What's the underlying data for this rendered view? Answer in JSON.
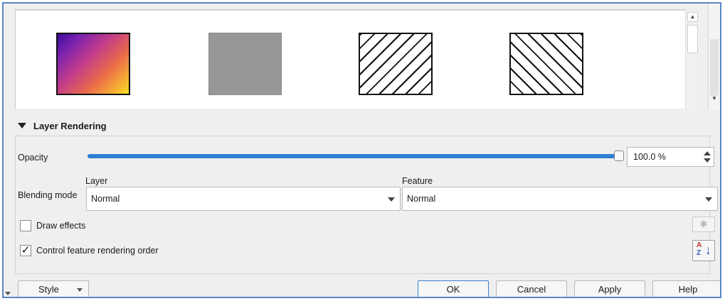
{
  "preview": {
    "symbols": [
      "gradient-fill",
      "solid-gray-fill",
      "hatch-fill-forward",
      "hatch-fill-back"
    ]
  },
  "layer_rendering": {
    "title": "Layer Rendering",
    "opacity_label": "Opacity",
    "opacity_value": "100.0 %",
    "opacity_fraction": 1.0,
    "blending_mode_label": "Blending mode",
    "layer_label": "Layer",
    "feature_label": "Feature",
    "layer_blend": "Normal",
    "feature_blend": "Normal",
    "draw_effects_label": "Draw effects",
    "draw_effects_checked": false,
    "order_label": "Control feature rendering order",
    "order_checked": true,
    "check_mark": "✓"
  },
  "buttons": {
    "style": "Style",
    "ok": "OK",
    "cancel": "Cancel",
    "apply": "Apply",
    "help": "Help"
  },
  "icons": {
    "collapse": "triangle-down-icon",
    "effects": "star-icon",
    "sort": "sort-az-icon"
  },
  "colors": {
    "accent": "#2f7fd4",
    "frame": "#5b86c5"
  }
}
